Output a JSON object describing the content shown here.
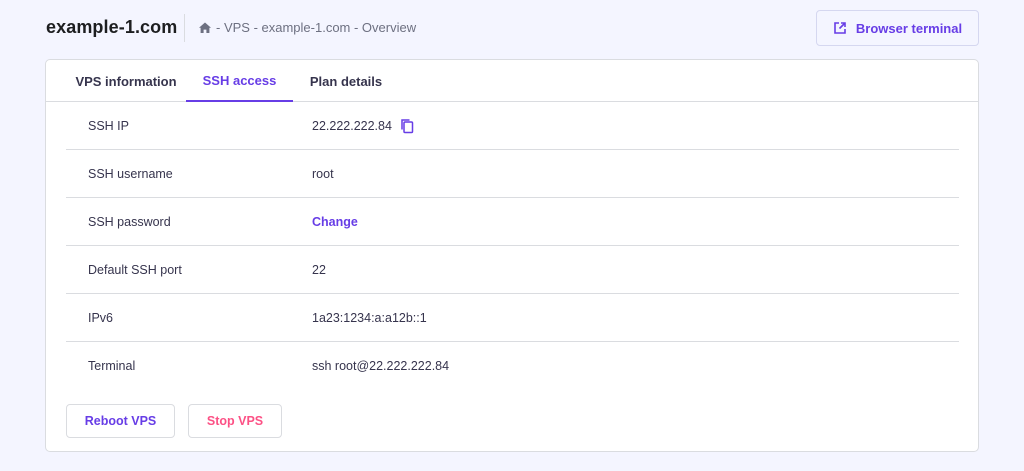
{
  "header": {
    "title": "example-1.com",
    "breadcrumb": {
      "home_icon": "home-icon",
      "text": "- VPS - example-1.com - Overview"
    },
    "browser_terminal_label": "Browser terminal",
    "browser_terminal_icon": "external-link-icon"
  },
  "tabs": [
    {
      "label": "VPS information",
      "active": false
    },
    {
      "label": "SSH access",
      "active": true
    },
    {
      "label": "Plan details",
      "active": false
    }
  ],
  "ssh": {
    "rows": [
      {
        "label": "SSH IP",
        "value": "22.222.222.84"
      },
      {
        "label": "SSH username",
        "value": "root"
      },
      {
        "label": "SSH password",
        "value": "Change"
      },
      {
        "label": "Default SSH port",
        "value": "22"
      },
      {
        "label": "IPv6",
        "value": "1a23:1234:a:a12b::1"
      },
      {
        "label": "Terminal",
        "value": "ssh root@22.222.222.84"
      }
    ]
  },
  "actions": {
    "reboot_label": "Reboot VPS",
    "stop_label": "Stop VPS"
  },
  "colors": {
    "accent": "#673de6",
    "danger": "#fc5185",
    "background": "#f4f5ff"
  }
}
